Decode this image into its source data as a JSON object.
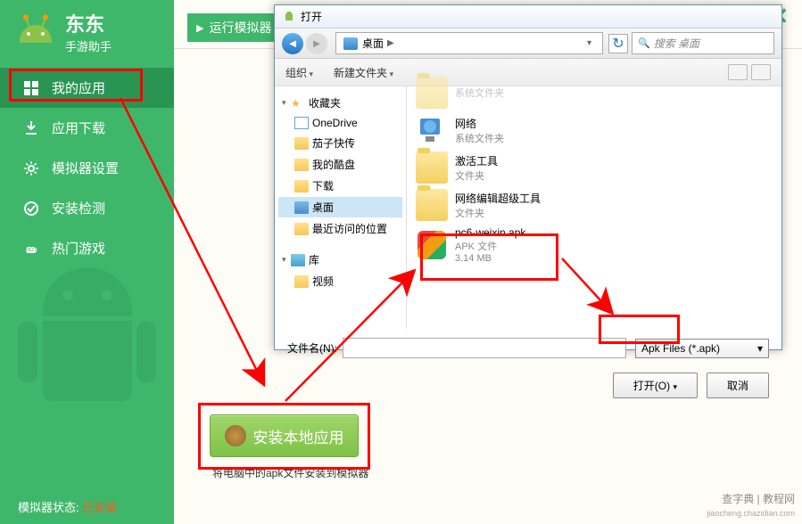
{
  "app": {
    "title": "东东",
    "subtitle": "手游助手"
  },
  "topbar": {
    "run": "运行模拟器"
  },
  "sidebar": {
    "items": [
      {
        "label": "我的应用"
      },
      {
        "label": "应用下载"
      },
      {
        "label": "模拟器设置"
      },
      {
        "label": "安装检测"
      },
      {
        "label": "热门游戏"
      }
    ]
  },
  "status": {
    "label": "模拟器状态:",
    "value": "已安装"
  },
  "install": {
    "button": "安装本地应用",
    "desc": "将电脑中的apk文件安装到模拟器"
  },
  "dialog": {
    "title": "打开",
    "breadcrumb": "桌面",
    "search_placeholder": "搜索 桌面",
    "toolbar": {
      "organize": "组织",
      "newfolder": "新建文件夹"
    },
    "tree": {
      "fav": "收藏夹",
      "items": [
        "OneDrive",
        "茄子快传",
        "我的酷盘",
        "下载",
        "桌面",
        "最近访问的位置"
      ],
      "lib": "库",
      "video": "视频"
    },
    "files": [
      {
        "name": "网络",
        "meta": "系统文件夹",
        "type": "net"
      },
      {
        "name": "激活工具",
        "meta": "文件夹",
        "type": "folder"
      },
      {
        "name": "网络编辑超级工具",
        "meta": "文件夹",
        "type": "folder"
      },
      {
        "name": "pc6-weixin.apk",
        "meta": "APK 文件",
        "size": "3.14 MB",
        "type": "apk"
      }
    ],
    "filename_label": "文件名(N):",
    "filter": "Apk Files (*.apk)",
    "open": "打开(O)",
    "cancel": "取消"
  },
  "watermark": {
    "main": "查字典 | 教程网",
    "sub": "jiaocheng.chazidian.com"
  }
}
